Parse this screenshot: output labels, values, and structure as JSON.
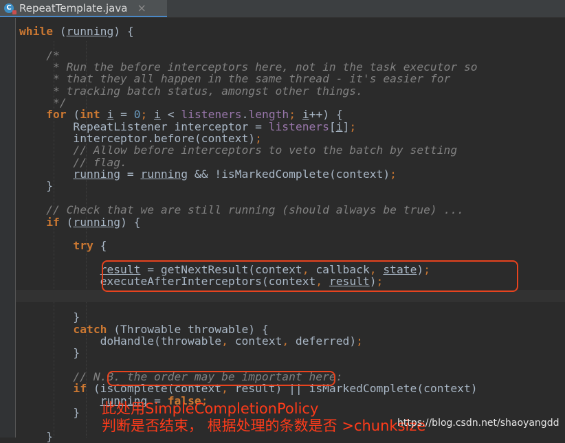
{
  "tab": {
    "icon_letter": "C",
    "title": "RepeatTemplate.java",
    "close_glyph": "×"
  },
  "code": {
    "lines": [
      [
        [
          "while",
          "k"
        ],
        [
          " ("
        ],
        [
          "running",
          "u"
        ],
        [
          ") {"
        ]
      ],
      [
        [
          ""
        ]
      ],
      [
        [
          "    /*",
          "c"
        ]
      ],
      [
        [
          "     * Run the before interceptors here, not in the task executor so",
          "c"
        ]
      ],
      [
        [
          "     * that they all happen in the same thread - it's easier for",
          "c"
        ]
      ],
      [
        [
          "     * tracking batch status, amongst other things.",
          "c"
        ]
      ],
      [
        [
          "     */",
          "c"
        ]
      ],
      [
        [
          "    "
        ],
        [
          "for",
          "k"
        ],
        [
          " ("
        ],
        [
          "int",
          "k"
        ],
        [
          " "
        ],
        [
          "i",
          "u"
        ],
        [
          " = "
        ],
        [
          "0",
          "n"
        ],
        [
          "; ",
          "p"
        ],
        [
          "i",
          "u"
        ],
        [
          " < "
        ],
        [
          "listeners",
          "f"
        ],
        [
          "."
        ],
        [
          "length",
          "f"
        ],
        [
          "; ",
          "p"
        ],
        [
          "i",
          "u"
        ],
        [
          "++) {"
        ]
      ],
      [
        [
          "        RepeatListener interceptor = "
        ],
        [
          "listeners",
          "f"
        ],
        [
          "["
        ],
        [
          "i",
          "u"
        ],
        [
          "]"
        ],
        [
          ";",
          "p"
        ]
      ],
      [
        [
          "        interceptor.before(context)"
        ],
        [
          ";",
          "p"
        ]
      ],
      [
        [
          "        // Allow before interceptors to veto the batch by setting",
          "c"
        ]
      ],
      [
        [
          "        // flag.",
          "c"
        ]
      ],
      [
        [
          "        "
        ],
        [
          "running",
          "u"
        ],
        [
          " = "
        ],
        [
          "running",
          "u"
        ],
        [
          " && !isMarkedComplete(context)"
        ],
        [
          ";",
          "p"
        ]
      ],
      [
        [
          "    }"
        ]
      ],
      [
        [
          ""
        ]
      ],
      [
        [
          "    // Check that we are still running (should always be true) ...",
          "c"
        ]
      ],
      [
        [
          "    "
        ],
        [
          "if",
          "k"
        ],
        [
          " ("
        ],
        [
          "running",
          "u"
        ],
        [
          ") {"
        ]
      ],
      [
        [
          ""
        ]
      ],
      [
        [
          "        "
        ],
        [
          "try",
          "k"
        ],
        [
          " {"
        ]
      ],
      [
        [
          ""
        ]
      ],
      [
        [
          "            "
        ],
        [
          "result",
          "u"
        ],
        [
          " = getNextResult(context"
        ],
        [
          ", ",
          "p"
        ],
        [
          "callback"
        ],
        [
          ", ",
          "p"
        ],
        [
          "state",
          "u"
        ],
        [
          ")"
        ],
        [
          ";",
          "p"
        ]
      ],
      [
        [
          "            executeAfterInterceptors(context"
        ],
        [
          ", ",
          "p"
        ],
        [
          "result",
          "u"
        ],
        [
          ")"
        ],
        [
          ";",
          "p"
        ]
      ],
      [
        [
          ""
        ]
      ],
      [
        [
          ""
        ]
      ],
      [
        [
          "        }"
        ]
      ],
      [
        [
          "        "
        ],
        [
          "catch",
          "k"
        ],
        [
          " (Throwable throwable) {"
        ]
      ],
      [
        [
          "            doHandle(throwable"
        ],
        [
          ", ",
          "p"
        ],
        [
          "context"
        ],
        [
          ", ",
          "p"
        ],
        [
          "deferred)"
        ],
        [
          ";",
          "p"
        ]
      ],
      [
        [
          "        }"
        ]
      ],
      [
        [
          ""
        ]
      ],
      [
        [
          "        // N.B. the order may be important here:",
          "c"
        ]
      ],
      [
        [
          "        "
        ],
        [
          "if",
          "k"
        ],
        [
          " (isComplete(context"
        ],
        [
          ", ",
          "p"
        ],
        [
          "result)"
        ],
        [
          " || isMarkedComplete(context)"
        ]
      ],
      [
        [
          "            "
        ],
        [
          "running",
          "u"
        ],
        [
          " = "
        ],
        [
          "false",
          "k"
        ],
        [
          ";",
          "p"
        ]
      ],
      [
        [
          "        }"
        ]
      ],
      [
        [
          ""
        ]
      ],
      [
        [
          "    }"
        ]
      ]
    ]
  },
  "annotation": {
    "line1": "此处用SimpleCompletionPolicy",
    "line2": "判断是否结束， 根据处理的条数是否 >chunksize"
  },
  "watermark": "https://blog.csdn.net/shaoyangdd",
  "colors": {
    "background": "#2b2b2b",
    "keyword": "#cc7832",
    "comment": "#808080",
    "number": "#6897bb",
    "field": "#9876aa",
    "text": "#a9b7c6",
    "highlight_box": "#e8431e"
  }
}
